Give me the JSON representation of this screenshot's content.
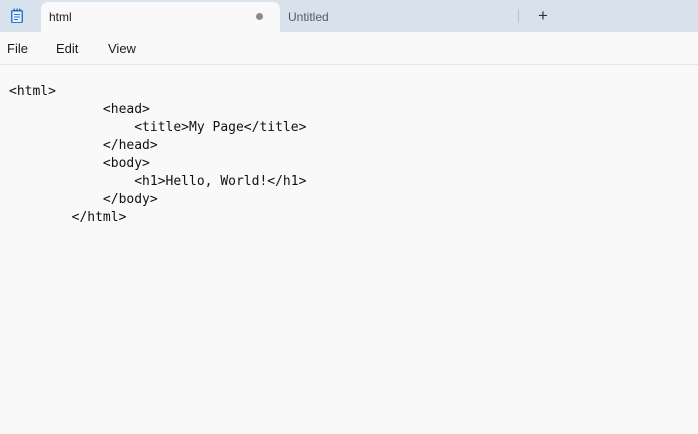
{
  "app": {
    "icon": "notepad-icon"
  },
  "tabs": [
    {
      "label": "html",
      "active": true,
      "modified": true
    },
    {
      "label": "Untitled",
      "active": false,
      "modified": false
    }
  ],
  "new_tab_label": "+",
  "menu": {
    "file": "File",
    "edit": "Edit",
    "view": "View"
  },
  "editor": {
    "lines": [
      "<html>",
      "            <head>",
      "                <title>My Page</title>",
      "            </head>",
      "            <body>",
      "                <h1>Hello, World!</h1>",
      "            </body>",
      "        </html>"
    ]
  }
}
